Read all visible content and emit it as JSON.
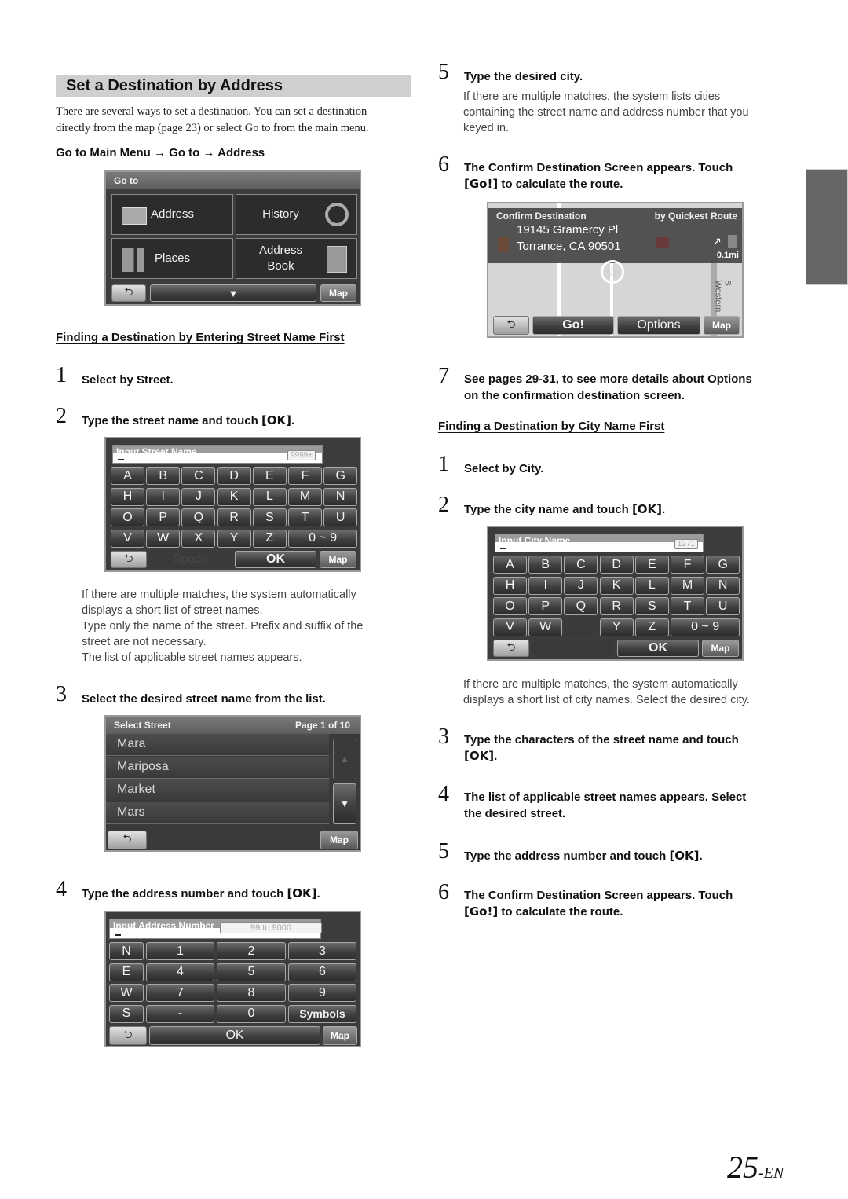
{
  "section": {
    "title": "Set a Destination by Address",
    "intro": [
      "There are several ways to set a destination. You can set a destination",
      "directly from the map (page 23) or select Go to from the main menu."
    ],
    "path": {
      "parts": [
        "Go to Main Menu",
        "Go to",
        "Address"
      ],
      "separator": "→"
    }
  },
  "goto_screen": {
    "title": "Go to",
    "tiles": [
      {
        "label": "Address",
        "icon": "address-card-icon"
      },
      {
        "label": "History",
        "icon": "history-icon"
      },
      {
        "label": "Places",
        "icon": "places-icon"
      },
      {
        "label": "Address Book",
        "label_lines": [
          "Address",
          "Book"
        ],
        "icon": "address-book-icon"
      }
    ],
    "back": "back-icon",
    "down": "chevron-down-icon",
    "map": "Map"
  },
  "street_first": {
    "heading": "Finding a Destination by Entering Street Name First",
    "steps": [
      {
        "num": "1",
        "text": "Select by Street."
      },
      {
        "num": "2",
        "text": "Type the street name and touch ",
        "kbd": "[OK]",
        "tail": "."
      },
      {
        "num": "3",
        "text": "Select the desired street name from the list."
      },
      {
        "num": "4",
        "text": "Type the address number and touch ",
        "kbd": "[OK]",
        "tail": "."
      }
    ],
    "note_lines": [
      "If there are multiple matches, the system automatically",
      "displays a short list of street names.",
      "Type only the name of the street. Prefix and suffix of the",
      "street are not necessary.",
      "The list of applicable street names appears."
    ]
  },
  "street_keyboard": {
    "label": "Input Street Name",
    "count": "9999+",
    "rows": [
      [
        "A",
        "B",
        "C",
        "D",
        "E",
        "F",
        "G"
      ],
      [
        "H",
        "I",
        "J",
        "K",
        "L",
        "M",
        "N"
      ],
      [
        "O",
        "P",
        "Q",
        "R",
        "S",
        "T",
        "U"
      ],
      [
        "V",
        "W",
        "X",
        "Y",
        "Z",
        "0 ~ 9"
      ]
    ],
    "space": "Space",
    "ok": "OK",
    "map": "Map"
  },
  "street_list": {
    "title": "Select Street",
    "page": "Page 1 of 10",
    "items": [
      "Mara",
      "Mariposa",
      "Market",
      "Mars"
    ],
    "map": "Map"
  },
  "number_keypad": {
    "label": "Input Address Number",
    "range": "99 to 9000",
    "rows": [
      [
        "N",
        "1",
        "2",
        "3"
      ],
      [
        "E",
        "4",
        "5",
        "6"
      ],
      [
        "W",
        "7",
        "8",
        "9"
      ],
      [
        "S",
        "-",
        "0",
        "Symbols"
      ]
    ],
    "ok": "OK",
    "map": "Map"
  },
  "right_steps_top": [
    {
      "num": "5",
      "text": "Type the desired city.",
      "note_lines": [
        "If there are multiple matches, the system lists cities",
        "containing the street name and address number that you",
        "keyed in."
      ]
    },
    {
      "num": "6",
      "text_lines": [
        "The Confirm Destination Screen appears. Touch"
      ],
      "kbd": "[Go!]",
      "tail": " to calculate the route."
    },
    {
      "num": "7",
      "text_lines": [
        "See pages 29-31, to see more details about Options",
        "on the confirmation destination screen."
      ]
    }
  ],
  "confirm_screen": {
    "title": "Confirm Destination",
    "route_type": "by Quickest Route",
    "address_line1": "19145 Gramercy Pl",
    "address_line2": "Torrance, CA 90501",
    "distance": "0.1mi",
    "street_label": "S Western",
    "go": "Go!",
    "options": "Options",
    "map": "Map"
  },
  "city_first": {
    "heading": "Finding a Destination by City Name First",
    "steps": [
      {
        "num": "1",
        "text": "Select by City."
      },
      {
        "num": "2",
        "text": "Type the city name and touch ",
        "kbd": "[OK]",
        "tail": "."
      },
      {
        "num": "3",
        "text": "Type the characters of the street name and touch",
        "kbd": "[OK]",
        "tail": "."
      },
      {
        "num": "4",
        "text_lines": [
          "The list of applicable street names appears. Select",
          "the desired street."
        ]
      },
      {
        "num": "5",
        "text": "Type the address number and touch ",
        "kbd": "[OK]",
        "tail": "."
      },
      {
        "num": "6",
        "text": "The Confirm Destination Screen appears. Touch",
        "kbd": "[Go!]",
        "tail": " to calculate the route."
      }
    ],
    "note_lines": [
      "If there are multiple matches, the system automatically",
      "displays a short list of city names. Select the desired city."
    ]
  },
  "city_keyboard": {
    "label": "Input City Name",
    "count": "1271",
    "rows": [
      [
        "A",
        "B",
        "C",
        "D",
        "E",
        "F",
        "G"
      ],
      [
        "H",
        "I",
        "J",
        "K",
        "L",
        "M",
        "N"
      ],
      [
        "O",
        "P",
        "Q",
        "R",
        "S",
        "T",
        "U"
      ],
      [
        "V",
        "W",
        "",
        "Y",
        "Z",
        "0 ~ 9"
      ]
    ],
    "ok": "OK",
    "map": "Map"
  },
  "footer": {
    "page": "25",
    "suffix": "-EN"
  },
  "colors": {
    "title_bar_bg": "#cfcfcf",
    "side_tab": "#666666",
    "screen_bg": "#3c3c3c"
  }
}
